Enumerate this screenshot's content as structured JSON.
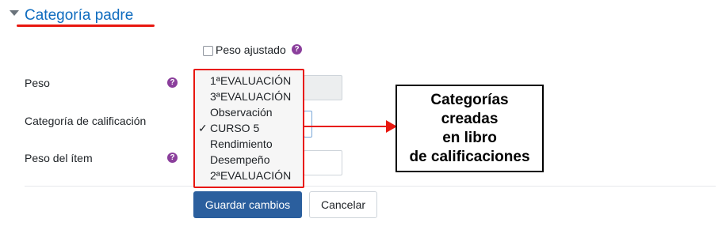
{
  "section": {
    "title": "Categoría padre"
  },
  "peso_ajustado": {
    "label": "Peso ajustado"
  },
  "fields": {
    "peso_label": "Peso",
    "categoria_label": "Categoría de calificación",
    "peso_item_label": "Peso del ítem"
  },
  "help_icon_glyph": "?",
  "dropdown": {
    "options": [
      {
        "label": "1ªEVALUACIÓN",
        "selected": false
      },
      {
        "label": "3ªEVALUACIÓN",
        "selected": false
      },
      {
        "label": "Observación",
        "selected": false
      },
      {
        "label": "CURSO 5",
        "selected": true,
        "check": "✓"
      },
      {
        "label": "Rendimiento",
        "selected": false
      },
      {
        "label": "Desempeño",
        "selected": false
      },
      {
        "label": "2ªEVALUACIÓN",
        "selected": false
      }
    ]
  },
  "buttons": {
    "save": "Guardar cambios",
    "cancel": "Cancelar"
  },
  "annotation": {
    "lines": [
      "Categorías",
      "creadas",
      "en libro",
      "de calificaciones"
    ]
  },
  "colors": {
    "accent": "#0f6cbf",
    "annotation_red": "#e8170f",
    "help_purple": "#8b3f9c",
    "primary_button": "#2b5f9e"
  }
}
